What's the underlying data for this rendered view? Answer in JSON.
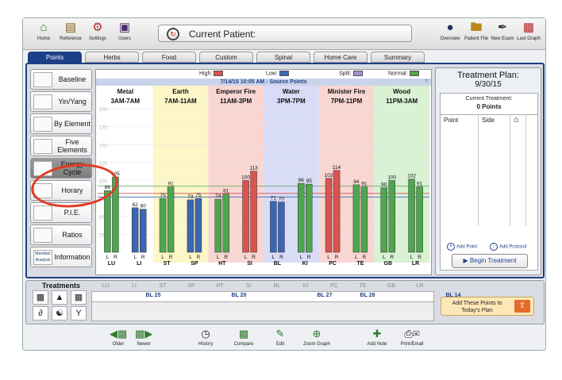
{
  "toolbar": {
    "left": [
      {
        "label": "Home",
        "icon": "home-icon"
      },
      {
        "label": "Reference",
        "icon": "book-icon"
      },
      {
        "label": "Settings",
        "icon": "gears-icon"
      },
      {
        "label": "Users",
        "icon": "briefcase-icon"
      }
    ],
    "patient_label": "Current Patient:",
    "right": [
      {
        "label": "Overview",
        "icon": "person-icon"
      },
      {
        "label": "Patient File",
        "icon": "folder-icon"
      },
      {
        "label": "New Exam",
        "icon": "pen-icon"
      },
      {
        "label": "Last Graph",
        "icon": "bar-chart-icon"
      }
    ]
  },
  "tabs": [
    "Points",
    "Herbs",
    "Food",
    "Custom",
    "Spinal",
    "Home Care",
    "Summary"
  ],
  "active_tab": "Points",
  "sidebar": [
    {
      "label": "Baseline"
    },
    {
      "label": "Yin/Yang"
    },
    {
      "label": "By Element"
    },
    {
      "label": "Five Elements"
    },
    {
      "label": "Energy Cycle"
    },
    {
      "label": "Horary"
    },
    {
      "label": "P.I.E."
    },
    {
      "label": "Ratios"
    },
    {
      "label": "Information",
      "icon_label": "Meridian Analysis"
    }
  ],
  "legend": [
    {
      "label": "High:",
      "color": "#d9534f"
    },
    {
      "label": "Low:",
      "color": "#3a66b4"
    },
    {
      "label": "Split:",
      "color": "#a98bd6"
    },
    {
      "label": "Normal:",
      "color": "#4ea64e"
    }
  ],
  "source_title": "7/14/15 10:05 AM - Source Points",
  "source_help": "?",
  "elements": [
    {
      "name": "Metal",
      "time": "3AM-7AM",
      "bg": "#ffffff"
    },
    {
      "name": "Earth",
      "time": "7AM-11AM",
      "bg": "#fdf6c8"
    },
    {
      "name": "Emperor Fire",
      "time": "11AM-3PM",
      "bg": "#f9d6d2"
    },
    {
      "name": "Water",
      "time": "3PM-7PM",
      "bg": "#d9dcf6"
    },
    {
      "name": "Minister Fire",
      "time": "7PM-11PM",
      "bg": "#f9d6d2"
    },
    {
      "name": "Wood",
      "time": "11PM-3AM",
      "bg": "#d9f2d4"
    }
  ],
  "chart_data": {
    "type": "bar",
    "ylim": [
      0,
      200
    ],
    "yticks": [
      "200",
      "175",
      "150",
      "125",
      "100",
      "75",
      "50",
      "25"
    ],
    "ref_lines": [
      {
        "value": 92,
        "color": "#4ea64e"
      },
      {
        "value": 82,
        "color": "#d9534f"
      },
      {
        "value": 77,
        "color": "#3a66b4"
      }
    ],
    "categories": [
      "LU",
      "LI",
      "ST",
      "SP",
      "HT",
      "SI",
      "BL",
      "KI",
      "PC",
      "TE",
      "GB",
      "LR"
    ],
    "series": [
      {
        "name": "L",
        "values": [
          86,
          62,
          75,
          73,
          74,
          100,
          71,
          96,
          103,
          94,
          90,
          102
        ]
      },
      {
        "name": "R",
        "values": [
          105,
          60,
          91,
          75,
          81,
          113,
          70,
          95,
          114,
          91,
          100,
          91
        ]
      }
    ],
    "bar_colors": [
      [
        "#4ea64e",
        "#4ea64e"
      ],
      [
        "#3a66b4",
        "#3a66b4"
      ],
      [
        "#4ea64e",
        "#4ea64e"
      ],
      [
        "#3a66b4",
        "#3a66b4"
      ],
      [
        "#4ea64e",
        "#4ea64e"
      ],
      [
        "#d9534f",
        "#d9534f"
      ],
      [
        "#3a66b4",
        "#3a66b4"
      ],
      [
        "#4ea64e",
        "#4ea64e"
      ],
      [
        "#d9534f",
        "#d9534f"
      ],
      [
        "#4ea64e",
        "#4ea64e"
      ],
      [
        "#4ea64e",
        "#4ea64e"
      ],
      [
        "#4ea64e",
        "#4ea64e"
      ]
    ],
    "bar_labels": [
      "L",
      "R"
    ]
  },
  "plan": {
    "title": "Treatment Plan:",
    "date": "9/30/15",
    "current_label": "Current Treatment:",
    "current_points": "0 Points",
    "col_point": "Point",
    "col_side": "Side",
    "add_point": "Add Point",
    "add_protocol": "Add Protocol",
    "begin": "Begin Treatment"
  },
  "treatments": {
    "title": "Treatments",
    "meridians": [
      "LU",
      "LI",
      "ST",
      "SP",
      "HT",
      "SI",
      "BL",
      "KI",
      "PC",
      "TE",
      "GB",
      "LR"
    ],
    "points": [
      {
        "label": "BL 25",
        "col": 1
      },
      {
        "label": "BL 20",
        "col": 3
      },
      {
        "label": "BL 27",
        "col": 5
      },
      {
        "label": "BL 28",
        "col": 6
      },
      {
        "label": "BL 14",
        "col": 8
      }
    ],
    "add_today": "Add These Points to Today's Plan"
  },
  "bottom": [
    {
      "label": "Older",
      "icon": "older-icon"
    },
    {
      "label": "Newer",
      "icon": "newer-icon"
    },
    {
      "label": "History",
      "icon": "clock-icon"
    },
    {
      "label": "Compare",
      "icon": "compare-icon"
    },
    {
      "label": "Edit",
      "icon": "edit-icon"
    },
    {
      "label": "Zoom Graph",
      "icon": "zoom-icon"
    },
    {
      "label": "Add Note",
      "icon": "add-note-icon"
    },
    {
      "label": "Print/Email",
      "icon": "print-icon"
    }
  ]
}
